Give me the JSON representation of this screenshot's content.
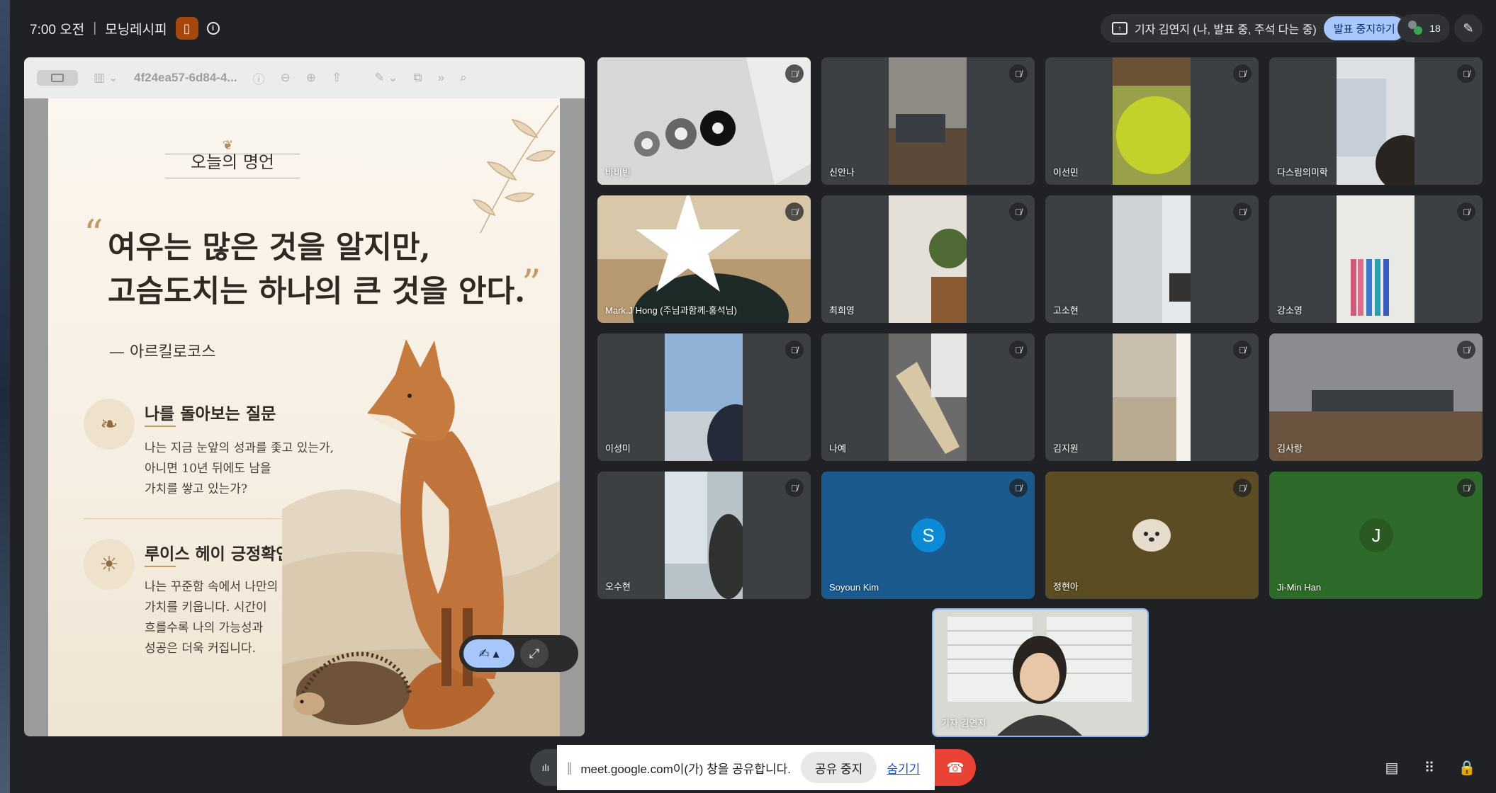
{
  "topbar": {
    "time": "7:00 오전",
    "separator": "|",
    "meeting_name": "모닝레시피",
    "presenting_label": "기자 김연지 (나, 발표 중, 주석 다는 중)",
    "stop_presenting": "발표 중지하기",
    "participant_count": "18"
  },
  "viewer": {
    "file_title": "4f24ea57-6d84-4..."
  },
  "slide": {
    "heading": "오늘의 명언",
    "quote_line1": "여우는 많은 것을 알지만,",
    "quote_line2": "고슴도치는 하나의 큰 것을 안다.",
    "quote_open": "“",
    "quote_close": "”",
    "author": "— 아르킬로코스",
    "section1_title": "나를 돌아보는 질문",
    "section1_line1": "나는 지금 눈앞의 성과를 좇고 있는가,",
    "section1_line2": "아니면 10년 뒤에도 남을",
    "section1_line3": "가치를 쌓고 있는가?",
    "section2_title": "루이스 헤이 긍정확언",
    "section2_line1": "나는 꾸준함 속에서 나만의",
    "section2_line2": "가치를 키웁니다. 시간이",
    "section2_line3": "흐를수록 나의 가능성과",
    "section2_line4": "성공은 더욱 커집니다."
  },
  "participants": [
    {
      "name": "바비빈"
    },
    {
      "name": "신안나"
    },
    {
      "name": "이선민"
    },
    {
      "name": "다스림의미학"
    },
    {
      "name": "Mark.J Hong (주님과함께-홍석님)"
    },
    {
      "name": "최희영"
    },
    {
      "name": "고소현"
    },
    {
      "name": "강소영"
    },
    {
      "name": "이성미"
    },
    {
      "name": "나예"
    },
    {
      "name": "김지원"
    },
    {
      "name": "김사랑"
    },
    {
      "name": "오수현"
    },
    {
      "name": "Soyoun Kim",
      "initial": "S"
    },
    {
      "name": "정현아"
    },
    {
      "name": "Ji-Min Han",
      "initial": "J"
    }
  ],
  "self": {
    "name": "기자 김연지"
  },
  "share_bar": {
    "message": "meet.google.com이(가) 창을 공유합니다.",
    "stop_label": "공유 중지",
    "hide_label": "숨기기"
  },
  "colors": {
    "background": "#202124",
    "tile": "#3c4043",
    "accent_blue": "#a8c7fa",
    "leave_red": "#ea4335",
    "soyoun_tile": "#1a5a8e",
    "jimin_tile": "#2e6b2a",
    "jeonghyun_tile": "#5b4c24"
  },
  "icons": [
    "present-screen-icon",
    "people-icon",
    "pencil-icon",
    "mic-off-icon",
    "hangup-icon",
    "chat-icon",
    "apps-icon",
    "lock-icon",
    "info-icon",
    "door-icon"
  ]
}
